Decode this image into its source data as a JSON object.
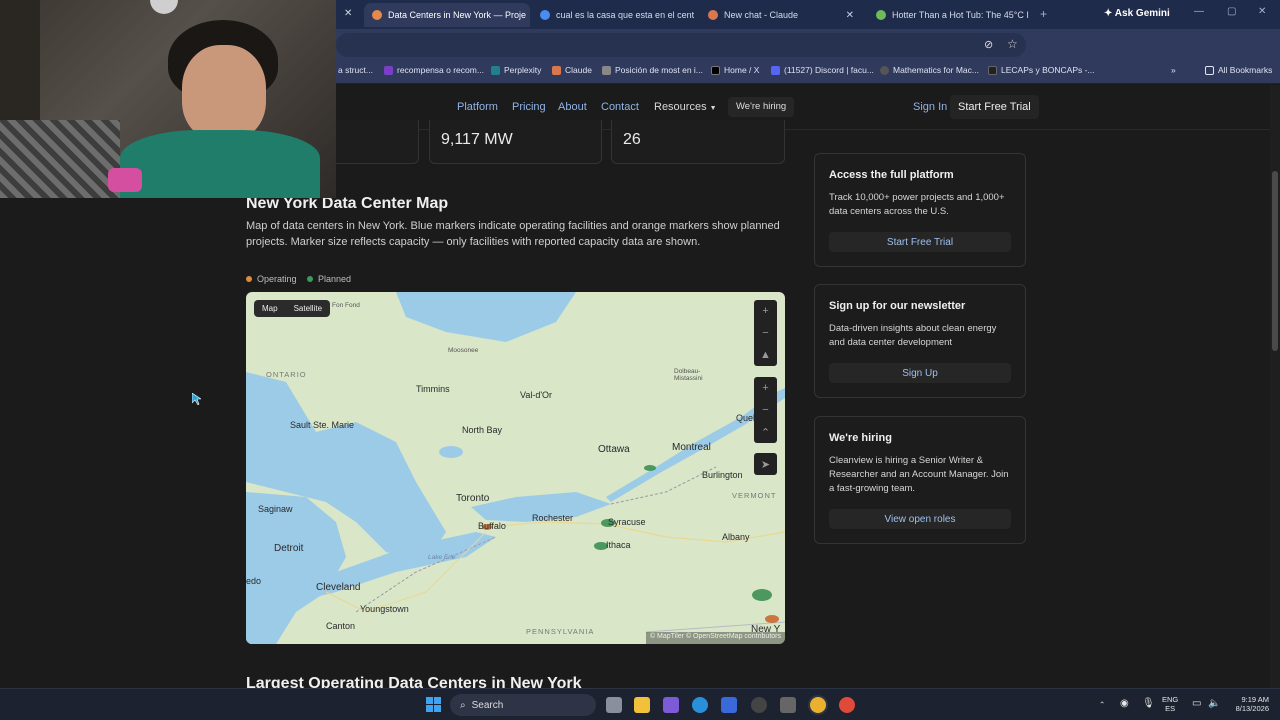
{
  "browser": {
    "tabs": [
      {
        "title": "Data Centers in New York — Proje",
        "color": "#e58a4a",
        "active": true
      },
      {
        "title": "cual es la casa que esta en el cent",
        "color": "#4a8df0",
        "active": false
      },
      {
        "title": "New chat - Claude",
        "color": "#d9774f",
        "active": false
      },
      {
        "title": "Hotter Than a Hot Tub: The 45°C I",
        "color": "#6dbb5a",
        "active": false
      }
    ],
    "new_tab": "+",
    "ask_gemini": "Ask Gemini",
    "bookmarks": [
      {
        "label": "a struct...",
        "color": "#6b6b6b"
      },
      {
        "label": "recompensa o recom...",
        "color": "#7b3ec9"
      },
      {
        "label": "Perplexity",
        "color": "#20808d"
      },
      {
        "label": "Claude",
        "color": "#d9774f"
      },
      {
        "label": "Posición de most en i...",
        "color": "#888888"
      },
      {
        "label": "Home / X",
        "color": "#000000"
      },
      {
        "label": "(11527) Discord | facu...",
        "color": "#5865f2"
      },
      {
        "label": "Mathematics for Mac...",
        "color": "#555555"
      },
      {
        "label": "LECAPs y BONCAPs -...",
        "color": "#222222"
      }
    ],
    "all_bookmarks": "All Bookmarks"
  },
  "nav": {
    "links": [
      "Platform",
      "Pricing",
      "About",
      "Contact",
      "Resources"
    ],
    "hiring": "We're hiring",
    "sign_in": "Sign In",
    "trial": "Start Free Trial"
  },
  "stats": {
    "capacity": "9,117 MW",
    "count": "26"
  },
  "map_section": {
    "title": "New York Data Center Map",
    "description": "Map of data centers in New York. Blue markers indicate operating facilities and orange markers show planned projects. Marker size reflects capacity — only facilities with reported capacity data are shown.",
    "legend": [
      {
        "label": "Operating",
        "color": "#e08a3c"
      },
      {
        "label": "Planned",
        "color": "#3c9a5f"
      }
    ],
    "toggle": {
      "map": "Map",
      "satellite": "Satellite"
    },
    "cities": {
      "fon_fond": "Fon Fond",
      "ontario": "ONTARIO",
      "moosonee": "Moosonee",
      "timmins": "Timmins",
      "val_dor": "Val-d'Or",
      "dolbeau": "Dolbeau-Mistassini",
      "sault": "Sault Ste. Marie",
      "north_bay": "North Bay",
      "ottawa": "Ottawa",
      "montreal": "Montreal",
      "quebec": "Queb",
      "burlington": "Burlington",
      "vermont": "VERMONT",
      "toronto": "Toronto",
      "rochester": "Rochester",
      "buffalo": "Buffalo",
      "syracuse": "Syracuse",
      "ithaca": "Ithaca",
      "albany": "Albany",
      "saginaw": "Saginaw",
      "detroit": "Detroit",
      "cleveland": "Cleveland",
      "youngstown": "Youngstown",
      "canton": "Canton",
      "pennsylvania": "PENNSYLVANIA",
      "new_york": "New Y",
      "toledo": "edo",
      "lake_erie": "Lake Erie"
    },
    "attribution": "© MapTiler © OpenStreetMap contributors"
  },
  "next_section_title": "Largest Operating Data Centers in New York",
  "sidebar": {
    "platform": {
      "title": "Access the full platform",
      "text": "Track 10,000+ power projects and 1,000+ data centers across the U.S.",
      "button": "Start Free Trial"
    },
    "newsletter": {
      "title": "Sign up for our newsletter",
      "text": "Data-driven insights about clean energy and data center development",
      "button": "Sign Up"
    },
    "hiring": {
      "title": "We're hiring",
      "text": "Cleanview is hiring a Senior Writer & Researcher and an Account Manager. Join a fast-growing team.",
      "button": "View open roles"
    }
  },
  "taskbar": {
    "search": "Search",
    "lang": "ENG",
    "lang2": "ES",
    "time": "9:19 AM",
    "date": "8/13/2026"
  }
}
